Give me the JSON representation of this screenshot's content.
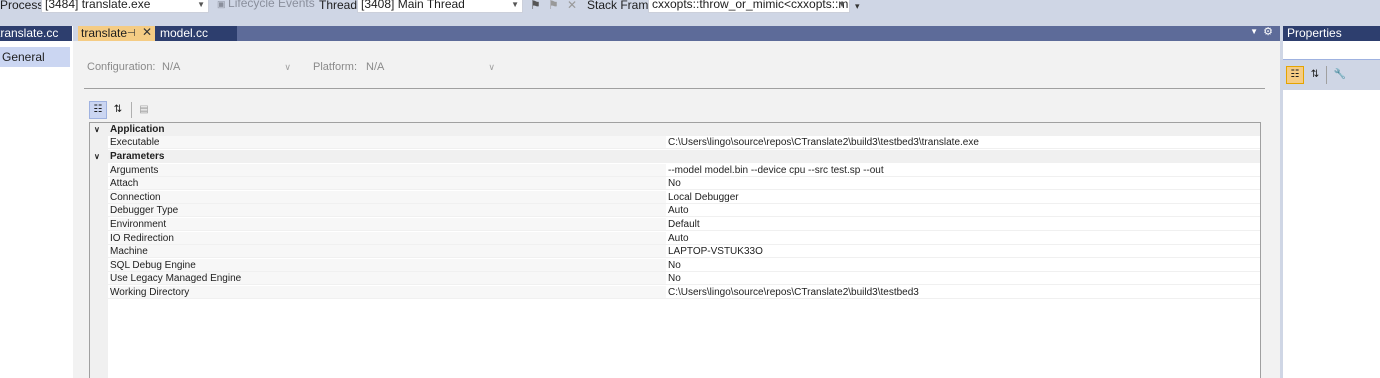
{
  "toolbar": {
    "process_label": "Process:",
    "process_value": "[3484] translate.exe",
    "lifecycle_label": "Lifecycle Events",
    "thread_label": "Thread:",
    "thread_value": "[3408] Main Thread",
    "stack_label": "Stack Frame:",
    "stack_value": "cxxopts::throw_or_mimic<cxxopts::missir"
  },
  "left_pane": {
    "tab_label": "translate.cc",
    "general_label": "General"
  },
  "tabs": {
    "active_label": "translate",
    "other_label": "model.cc"
  },
  "config": {
    "configuration_label": "Configuration:",
    "configuration_value": "N/A",
    "platform_label": "Platform:",
    "platform_value": "N/A"
  },
  "grid": {
    "categories": {
      "application": "Application",
      "parameters": "Parameters"
    },
    "rows": [
      {
        "name": "Executable",
        "value": "C:\\Users\\lingo\\source\\repos\\CTranslate2\\build3\\testbed3\\translate.exe"
      },
      {
        "name": "Arguments",
        "value": "--model model.bin --device cpu --src test.sp --out"
      },
      {
        "name": "Attach",
        "value": "No"
      },
      {
        "name": "Connection",
        "value": "Local Debugger"
      },
      {
        "name": "Debugger Type",
        "value": "Auto"
      },
      {
        "name": "Environment",
        "value": "Default"
      },
      {
        "name": "IO Redirection",
        "value": "Auto"
      },
      {
        "name": "Machine",
        "value": "LAPTOP-VSTUK33O"
      },
      {
        "name": "SQL Debug Engine",
        "value": "No"
      },
      {
        "name": "Use Legacy Managed Engine",
        "value": "No"
      },
      {
        "name": "Working Directory",
        "value": "C:\\Users\\lingo\\source\\repos\\CTranslate2\\build3\\testbed3"
      }
    ]
  },
  "properties_pane": {
    "title": "Properties"
  }
}
